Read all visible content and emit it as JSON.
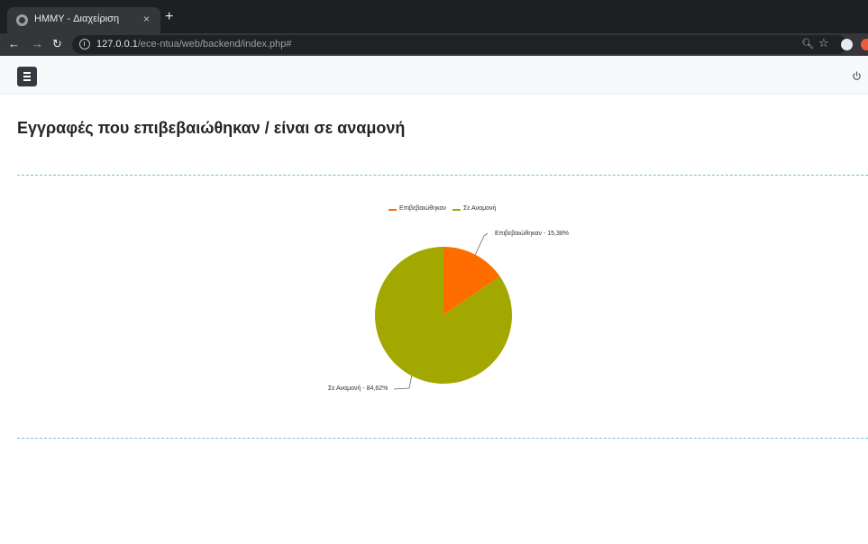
{
  "browser": {
    "tab_title": "HMMY - Διαχείριση",
    "tab_close": "×",
    "new_tab": "+",
    "url_host": "127.0.0.1",
    "url_path": "/ece-ntua/web/backend/index.php#"
  },
  "page": {
    "title": "Εγγραφές που επιβεβαιώθηκαν / είναι σε αναμονή"
  },
  "colors": {
    "confirmed": "#ff6d00",
    "pending": "#a3a800"
  },
  "chart_data": {
    "type": "pie",
    "title": "",
    "legend_position": "top",
    "series": [
      {
        "name": "Επιβεβαιώθηκαν",
        "value": 15.38,
        "color": "#ff6d00",
        "label": "Επιβεβαιώθηκαν - 15,38%"
      },
      {
        "name": "Σε Αναμονή",
        "value": 84.62,
        "color": "#a3a800",
        "label": "Σε Αναμονή - 84,62%"
      }
    ]
  }
}
